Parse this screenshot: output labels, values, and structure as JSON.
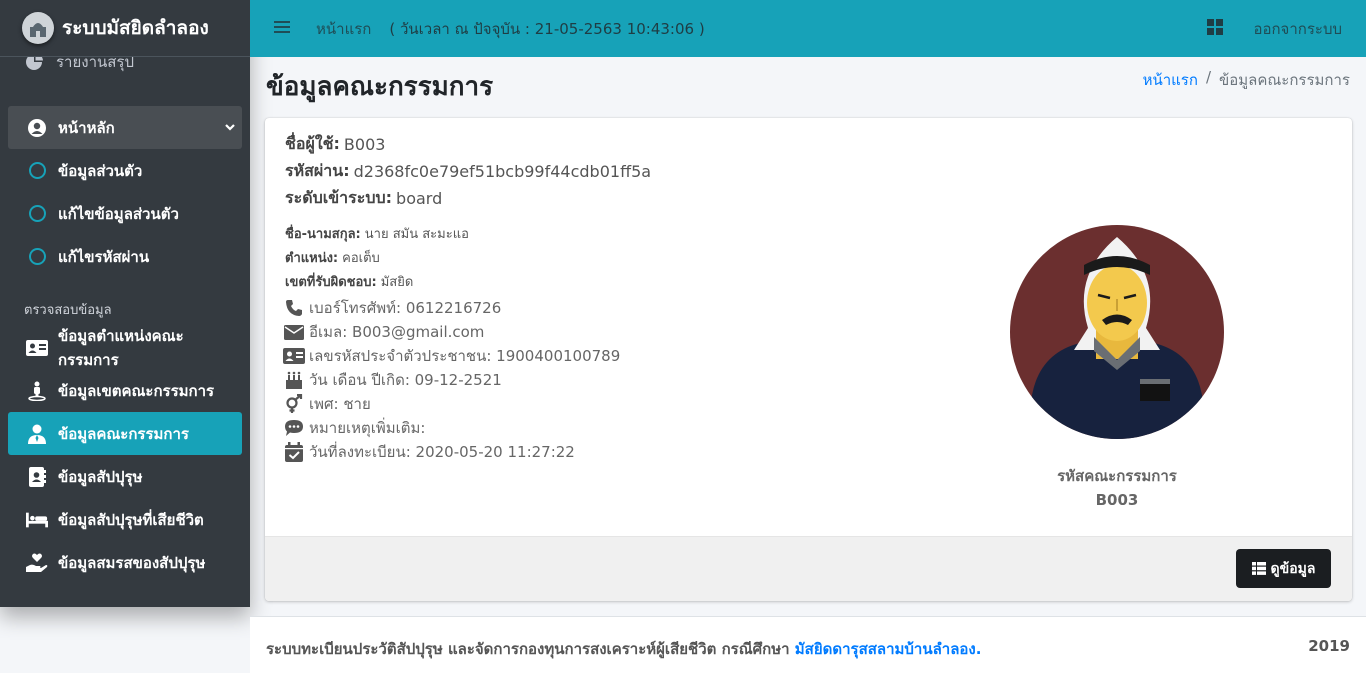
{
  "app": {
    "brand": "ระบบมัสยิดลำลอง"
  },
  "sidebar": {
    "report_item": "รายงานสรุป",
    "main_menu": "หน้าหลัก",
    "sub_items": [
      "ข้อมูลส่วนตัว",
      "แก้ไขข้อมูลส่วนตัว",
      "แก้ไขรหัสผ่าน"
    ],
    "section_header": "ตรวจสอบข้อมูล",
    "items": [
      "ข้อมูลตำแหน่งคณะกรรมการ",
      "ข้อมูลเขตคณะกรรมการ",
      "ข้อมูลคณะกรรมการ",
      "ข้อมูลสัปปุรุษ",
      "ข้อมูลสัปปุรุษที่เสียชีวิต",
      "ข้อมูลสมรสของสัปปุรุษ"
    ],
    "active_index": 2
  },
  "topbar": {
    "home": "หน้าแรก",
    "datetime": "( วันเวลา ณ ปัจจุบัน : 21-05-2563 10:43:06 )",
    "logout": "ออกจากระบบ"
  },
  "page": {
    "title": "ข้อมูลคณะกรรมการ",
    "breadcrumb_home": "หน้าแรก",
    "breadcrumb_sep": "/",
    "breadcrumb_current": "ข้อมูลคณะกรรมการ"
  },
  "profile": {
    "username_label": "ชื่อผู้ใช้:",
    "username": "B003",
    "password_label": "รหัสผ่าน:",
    "password": "d2368fc0e79ef51bcb99f44cdb01ff5a",
    "level_label": "ระดับเข้าระบบ:",
    "level": "board",
    "name_label": "ชื่อ-นามสกุล:",
    "name": "นาย สมัน สะมะแอ",
    "position_label": "ตำแหน่ง:",
    "position": "คอเต็บ",
    "zone_label": "เขตที่รับผิดชอบ:",
    "zone": "มัสยิด",
    "phone": "เบอร์โทรศัพท์: 0612216726",
    "email": "อีเมล: B003@gmail.com",
    "citizen_id": "เลขรหัสประจำตัวประชาชน: 1900400100789",
    "birthdate": "วัน เดือน ปีเกิด: 09-12-2521",
    "gender": "เพศ: ชาย",
    "note": "หมายเหตุเพิ่มเติม:",
    "registered": "วันที่ลงทะเบียน: 2020-05-20 11:27:22",
    "member_code_label": "รหัสคณะกรรมการ",
    "member_code": "B003",
    "view_button": "ดูข้อมูล"
  },
  "footer": {
    "text": "ระบบทะเบียนประวัติสัปปุรุษ และจัดการกองทุนการสงเคราะห์ผู้เสียชีวิต กรณีศึกษา",
    "link": "มัสยิดดารุสสลามบ้านลำลอง.",
    "year": "2019"
  },
  "colors": {
    "accent": "#17a2b8",
    "sidebar": "#343a40",
    "avatar_bg": "#6b2f2f"
  }
}
